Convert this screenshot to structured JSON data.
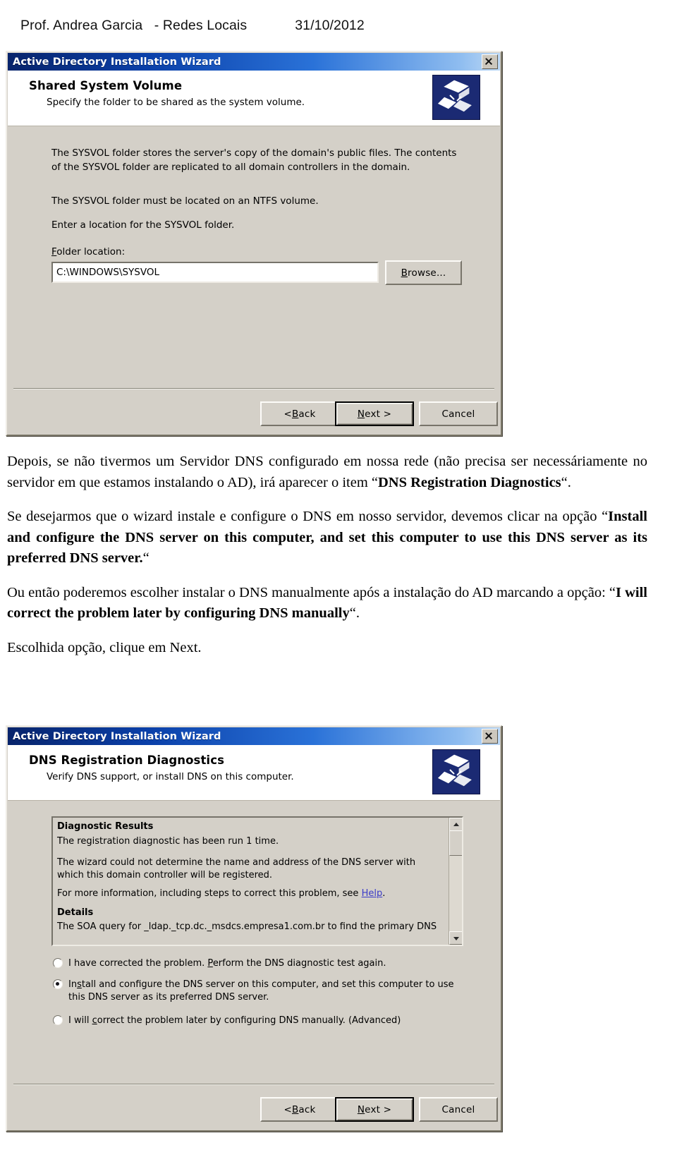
{
  "page_header": {
    "author": "Prof. Andrea Garcia   - Redes Locais",
    "date": "31/10/2012"
  },
  "dialog1": {
    "window_title": "Active Directory Installation Wizard",
    "close_label": "Close",
    "banner_title": "Shared System Volume",
    "banner_subtitle": "Specify the folder to be shared as the system volume.",
    "paragraph1": "The SYSVOL folder stores the server's copy of the domain's public files. The contents of the SYSVOL folder are replicated to all domain controllers in the domain.",
    "paragraph2": "The SYSVOL folder must be located on an NTFS volume.",
    "paragraph3": "Enter a location for the SYSVOL folder.",
    "folder_label_accel": "F",
    "folder_label_rest": "older location:",
    "folder_value": "C:\\WINDOWS\\SYSVOL",
    "browse_accel": "B",
    "browse_rest": "rowse...",
    "back_accel": "B",
    "back_prefix": "< ",
    "back_rest": "ack",
    "next_accel": "N",
    "next_rest": "ext >",
    "cancel_label": "Cancel"
  },
  "prose": {
    "p1_a": "Depois, se não tivermos um Servidor DNS configurado em nossa rede (não precisa ser necessáriamente no servidor em que estamos instalando o AD), irá aparecer o item “",
    "p1_b": "DNS Registration Diagnostics",
    "p1_c": "“.",
    "p2_a": "Se desejarmos que o wizard instale e configure o DNS em nosso servidor, devemos clicar na opção “",
    "p2_b": "Install and configure the DNS server on this computer, and set this computer to use this DNS server as its preferred DNS server.",
    "p2_c": "“",
    "p3_a": "Ou então poderemos escolher instalar o DNS manualmente após a instalação do AD marcando a opção: “",
    "p3_b": "I will correct the problem later by configuring DNS manually",
    "p3_c": "“.",
    "p4": "Escolhida opção, clique em Next."
  },
  "dialog2": {
    "window_title": "Active Directory Installation Wizard",
    "close_label": "Close",
    "banner_title": "DNS Registration Diagnostics",
    "banner_subtitle": "Verify DNS support, or install DNS on this computer.",
    "results_heading": "Diagnostic Results",
    "results_line1": "The registration diagnostic has been run 1 time.",
    "results_line2": "The wizard could not determine the name and address of the DNS server with which this domain controller will be registered.",
    "results_line3_pre": "For more information, including steps to correct this problem, see ",
    "results_line3_link": "Help",
    "results_line3_post": ".",
    "details_heading": "Details",
    "details_line": "The SOA query for _ldap._tcp.dc._msdcs.empresa1.com.br to find the primary DNS",
    "radio1_pre": "I have corrected the problem. ",
    "radio1_accel": "P",
    "radio1_post": "erform the DNS diagnostic test again.",
    "radio1_checked": false,
    "radio2_pre": "In",
    "radio2_accel": "s",
    "radio2_post": "tall and configure the DNS server on this computer, and set this computer to use this DNS server as its preferred DNS server.",
    "radio2_checked": true,
    "radio3_pre": "I will ",
    "radio3_accel": "c",
    "radio3_post": "orrect the problem later by configuring DNS manually. (Advanced)",
    "radio3_checked": false,
    "back_accel": "B",
    "back_prefix": "< ",
    "back_rest": "ack",
    "next_accel": "N",
    "next_rest": "ext >",
    "cancel_label": "Cancel"
  }
}
